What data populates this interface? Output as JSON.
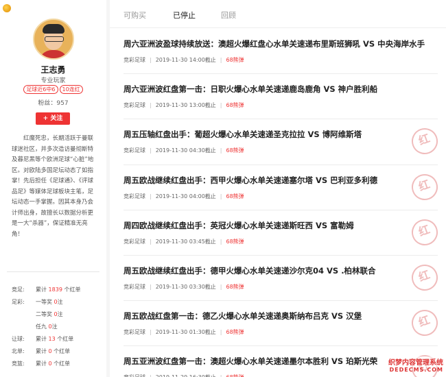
{
  "sidebar": {
    "name": "王志勇",
    "role": "专业玩家",
    "badges": [
      "足球近6中6",
      "10连红"
    ],
    "fans_label": "粉丝：",
    "fans_count": "957",
    "follow_label": "+ 关注",
    "bio": "红魔死忠，长期活跃于曼联球迷社区，并多次造访曼彻斯特及暮尼黑等个欧洲足球“心脏”地区。对欧陆多国足坛动态了如指掌！先后担任《足球通》、《评球品足》等媒体足球板块主笔，足坛动态一手掌握。因其本身乃会计师出身，故擅长以数据分析更是一大“杀器”，保证精准无亮角！",
    "stats": [
      {
        "label": "竞足:",
        "prefix": "累计 ",
        "num": "1839",
        "suffix": " 个红单"
      },
      {
        "label": "足彩:",
        "prefix": "一等奖 ",
        "num": "0",
        "suffix": "注"
      },
      {
        "label": "",
        "prefix": "二等奖 ",
        "num": "0",
        "suffix": "注"
      },
      {
        "label": "",
        "prefix": "任九 ",
        "num": "0",
        "suffix": "注"
      },
      {
        "label": "让球:",
        "prefix": "累计 ",
        "num": "13",
        "suffix": " 个红单"
      },
      {
        "label": "北单:",
        "prefix": "累计 ",
        "num": "0",
        "suffix": " 个红单"
      },
      {
        "label": "竞篮:",
        "prefix": "累计 ",
        "num": "0",
        "suffix": " 个红单"
      }
    ]
  },
  "tabs": [
    "可购买",
    "已停止",
    "回顾"
  ],
  "articles": [
    {
      "title": "周六亚洲波盈球持续放送：澳超火爆红盘心水单关速递布里斯班狮吼 VS 中央海岸水手",
      "category": "竞彩足球",
      "time": "2019-11-30 14:00截止",
      "price": "68熊弹",
      "stamp": false
    },
    {
      "title": "周六亚洲波红盘第一击：日职火爆心水单关速递鹿岛鹿角 VS 神户胜利船",
      "category": "竞彩足球",
      "time": "2019-11-30 13:00截止",
      "price": "68熊弹",
      "stamp": false
    },
    {
      "title": "周五压轴红盘出手：葡超火爆心水单关速递圣克拉拉 VS 博阿维斯塔",
      "category": "竞彩足球",
      "time": "2019-11-30 04:30截止",
      "price": "68熊弹",
      "stamp": true
    },
    {
      "title": "周五欧战继续红盘出手：西甲火爆心水单关速递塞尔塔 VS 巴利亚多利德",
      "category": "竞彩足球",
      "time": "2019-11-30 04:00截止",
      "price": "68熊弹",
      "stamp": true
    },
    {
      "title": "周四欧战继续红盘出手：英冠火爆心水单关速递斯旺西 VS 富勒姆",
      "category": "竞彩足球",
      "time": "2019-11-30 03:45截止",
      "price": "68熊弹",
      "stamp": true
    },
    {
      "title": "周五欧战继续红盘出手：德甲火爆心水单关速递沙尔克04 VS .柏林联合",
      "category": "竞彩足球",
      "time": "2019-11-30 03:30截止",
      "price": "68熊弹",
      "stamp": true
    },
    {
      "title": "周五欧战红盘第一击：德乙火爆心水单关速递奥斯纳布吕克 VS 汉堡",
      "category": "竞彩足球",
      "time": "2019-11-30 01:30截止",
      "price": "68熊弹",
      "stamp": true
    },
    {
      "title": "周五亚洲波红盘第一击：澳超火爆心水单关速递墨尔本胜利 VS 珀斯光荣",
      "category": "竞彩足球",
      "time": "2019-11-29 16:30截止",
      "price": "68熊弹",
      "stamp": true
    }
  ],
  "stamp_text": "红",
  "watermark": {
    "line1": "织梦内容管理系统",
    "line2": "DEDECMS.COM"
  }
}
